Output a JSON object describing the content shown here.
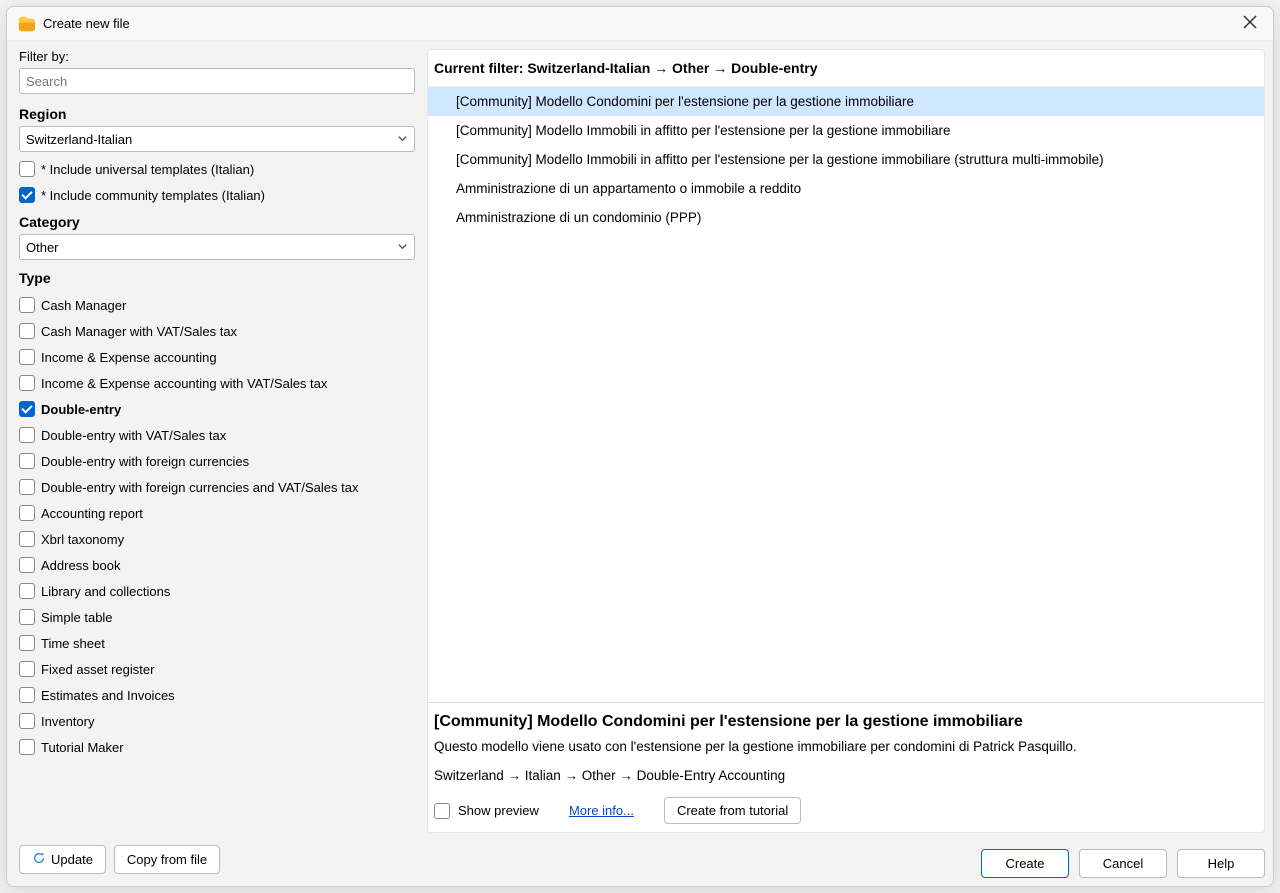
{
  "window": {
    "title": "Create new file"
  },
  "filter": {
    "label": "Filter by:",
    "search_placeholder": "Search",
    "search_value": ""
  },
  "region": {
    "label": "Region",
    "selected": "Switzerland-Italian",
    "include_universal": {
      "checked": false,
      "label": "* Include universal templates (Italian)"
    },
    "include_community": {
      "checked": true,
      "label": "* Include community templates (Italian)"
    }
  },
  "category": {
    "label": "Category",
    "selected": "Other"
  },
  "type": {
    "label": "Type",
    "items": [
      {
        "label": "Cash Manager",
        "checked": false
      },
      {
        "label": "Cash Manager with VAT/Sales tax",
        "checked": false
      },
      {
        "label": "Income & Expense accounting",
        "checked": false
      },
      {
        "label": "Income & Expense accounting with VAT/Sales tax",
        "checked": false
      },
      {
        "label": "Double-entry",
        "checked": true
      },
      {
        "label": "Double-entry with VAT/Sales tax",
        "checked": false
      },
      {
        "label": "Double-entry with foreign currencies",
        "checked": false
      },
      {
        "label": "Double-entry with foreign currencies and VAT/Sales tax",
        "checked": false
      },
      {
        "label": "Accounting report",
        "checked": false
      },
      {
        "label": "Xbrl taxonomy",
        "checked": false
      },
      {
        "label": "Address book",
        "checked": false
      },
      {
        "label": "Library and collections",
        "checked": false
      },
      {
        "label": "Simple table",
        "checked": false
      },
      {
        "label": "Time sheet",
        "checked": false
      },
      {
        "label": "Fixed asset register",
        "checked": false
      },
      {
        "label": "Estimates and Invoices",
        "checked": false
      },
      {
        "label": "Inventory",
        "checked": false
      },
      {
        "label": "Tutorial Maker",
        "checked": false
      }
    ]
  },
  "left_buttons": {
    "update": "Update",
    "copy_from_file": "Copy from file"
  },
  "results": {
    "header": "Current filter: Switzerland-Italian → Other → Double-entry",
    "items": [
      {
        "label": "[Community] Modello Condomini per l'estensione per la gestione immobiliare",
        "selected": true
      },
      {
        "label": "[Community] Modello Immobili in affitto per l'estensione per la gestione immobiliare",
        "selected": false
      },
      {
        "label": "[Community] Modello Immobili in affitto per l'estensione per la gestione immobiliare (struttura multi-immobile)",
        "selected": false
      },
      {
        "label": "Amministrazione di un appartamento o immobile a reddito",
        "selected": false
      },
      {
        "label": "Amministrazione di un condominio (PPP)",
        "selected": false
      }
    ]
  },
  "details": {
    "title": "[Community] Modello Condomini per l'estensione per la gestione immobiliare",
    "description": "Questo modello viene usato con l'estensione per la gestione immobiliare per condomini di Patrick Pasquillo.",
    "path": "Switzerland → Italian → Other → Double-Entry Accounting",
    "show_preview_label": "Show preview",
    "show_preview_checked": false,
    "more_info": "More info...",
    "create_from_tutorial": "Create from tutorial"
  },
  "footer": {
    "create": "Create",
    "cancel": "Cancel",
    "help": "Help"
  }
}
